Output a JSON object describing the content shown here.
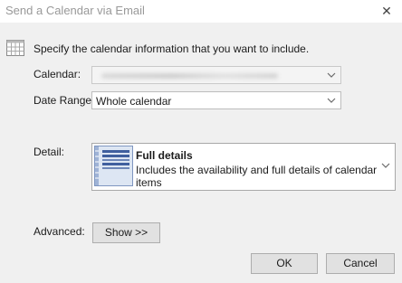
{
  "dialog": {
    "title": "Send a Calendar via Email",
    "instruction": "Specify the calendar information that you want to include."
  },
  "fields": {
    "calendar_label": "Calendar:",
    "calendar_value": "",
    "date_range_label": "Date Range:",
    "date_range_value": "Whole calendar",
    "detail_label": "Detail:",
    "detail_title": "Full details",
    "detail_description": "Includes the availability and full details of calendar items",
    "advanced_label": "Advanced:"
  },
  "buttons": {
    "show": "Show >>",
    "ok": "OK",
    "cancel": "Cancel",
    "close": "✕"
  },
  "icons": {
    "calendar": "calendar-icon",
    "details_thumbnail": "full-details-thumbnail-icon",
    "dropdown": "chevron-down-icon"
  },
  "colors": {
    "dialog_bg": "#f0f0f0",
    "title_text": "#999999",
    "thumbnail_accent": "#3f5f9e"
  }
}
